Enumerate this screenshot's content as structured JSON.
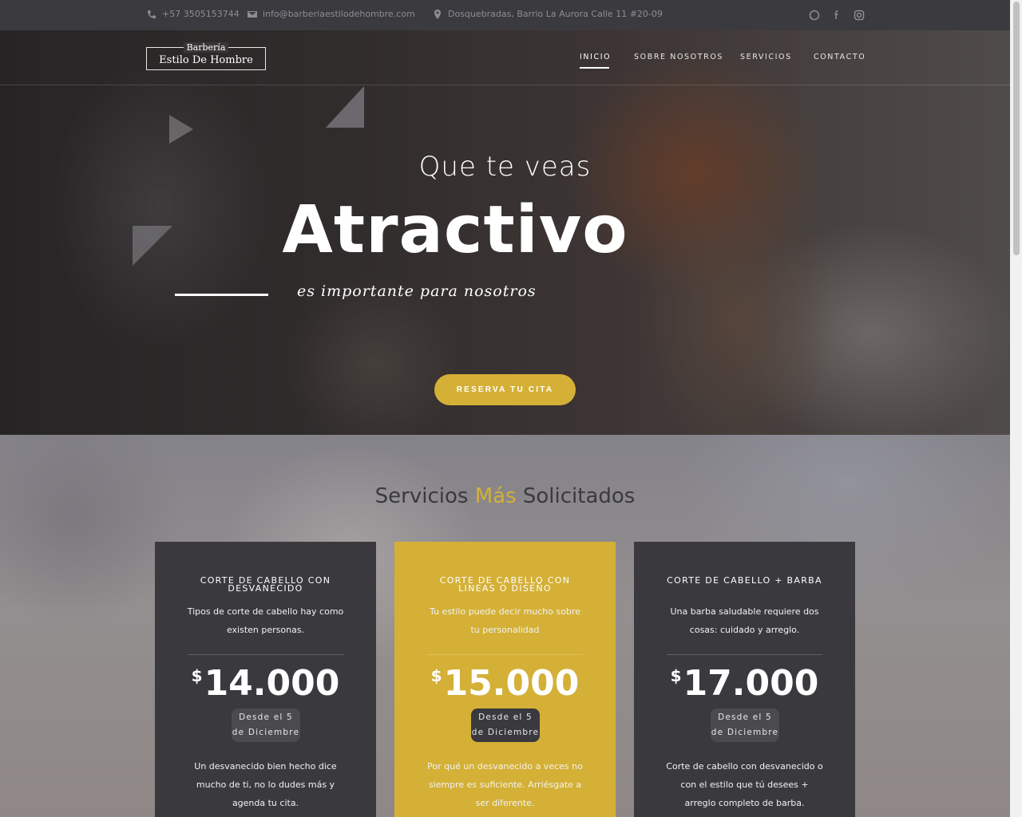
{
  "topbar": {
    "phone": "+57 3505153744",
    "email": "info@barberiaestilodehombre.com",
    "address": "Dosquebradas, Barrio La Aurora Calle 11 #20-09",
    "socials": [
      "whatsapp-icon",
      "facebook-icon",
      "instagram-icon"
    ]
  },
  "logo": {
    "line1": "Barbería",
    "line2": "Estilo De Hombre"
  },
  "nav": [
    {
      "label": "INICIO",
      "active": true
    },
    {
      "label": "SOBRE NOSOTROS",
      "active": false
    },
    {
      "label": "SERVICIOS",
      "active": false
    },
    {
      "label": "CONTACTO",
      "active": false
    }
  ],
  "hero": {
    "kicker": "Que te veas",
    "headline": "Atractivo",
    "subtitle": "es importante para nosotros",
    "cta": "RESERVA TU CITA"
  },
  "services": {
    "title_a": "Servicios ",
    "title_accent": "Más",
    "title_b": " Solicitados",
    "cards": [
      {
        "title": "CORTE DE CABELLO CON DESVANECIDO",
        "description": "Tipos de corte de cabello hay como existen personas.",
        "currency": "$",
        "price": "14.000",
        "since": "Desde el 5 de Diciembre",
        "body": "Un desvanecido bien hecho dice mucho de ti, no lo dudes más y agenda tu cita."
      },
      {
        "title": "CORTE DE CABELLO CON LINEAS O DISEÑO",
        "description": "Tu estilo puede decir mucho sobre tu personalidad",
        "currency": "$",
        "price": "15.000",
        "since": "Desde el 5 de Diciembre",
        "body": "Por qué un desvanecido a veces no siempre es suficiente. Arriésgate a ser diferente."
      },
      {
        "title": "CORTE DE CABELLO + BARBA",
        "description": "Una barba saludable requiere dos cosas: cuidado y arreglo.",
        "currency": "$",
        "price": "17.000",
        "since": "Desde el 5 de Diciembre",
        "body": "Corte de cabello con desvanecido o con el estilo que tú desees + arreglo completo de barba."
      }
    ]
  },
  "colors": {
    "accent": "#d4b036",
    "dark": "#3a393d",
    "text": "#ffffff"
  }
}
